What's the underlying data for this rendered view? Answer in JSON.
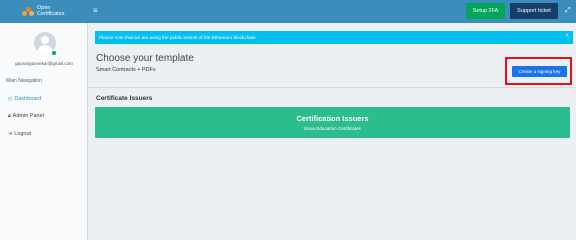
{
  "header": {
    "logo_text_line1": "Open",
    "logo_text_line2": "Certificates",
    "menu_icon": "hamburger-icon",
    "setup_2fa_label": "Setup 2FA",
    "support_ticket_label": "Support ticket",
    "expand_icon": "expand-icon"
  },
  "sidebar": {
    "email": "gaurangtorvekar@gmail.com",
    "nav_header": "Main Navigation",
    "items": [
      {
        "label": "Dashboard",
        "icon": "dashboard-icon",
        "active": true
      },
      {
        "label": "Admin Panel",
        "icon": "lock-icon",
        "active": false
      },
      {
        "label": "Logout",
        "icon": "logout-icon",
        "active": false
      }
    ]
  },
  "alert": {
    "text": "Please note that we are using the public testnet of the Ethereum blockchain",
    "close": "×"
  },
  "main": {
    "title": "Choose your template",
    "subtitle": "Smart Contracts + PDFs",
    "signing_key_button": "Create a signing key",
    "section_title": "Certificate Issuers",
    "card_title": "Certification Issuers",
    "card_subtitle": "Issue Education Certificates"
  },
  "colors": {
    "header": "#3c8dbc",
    "green": "#00a65a",
    "navy": "#173d6b",
    "alert": "#00c0ef",
    "card": "#2bbd8e",
    "highlight": "#e81010"
  }
}
